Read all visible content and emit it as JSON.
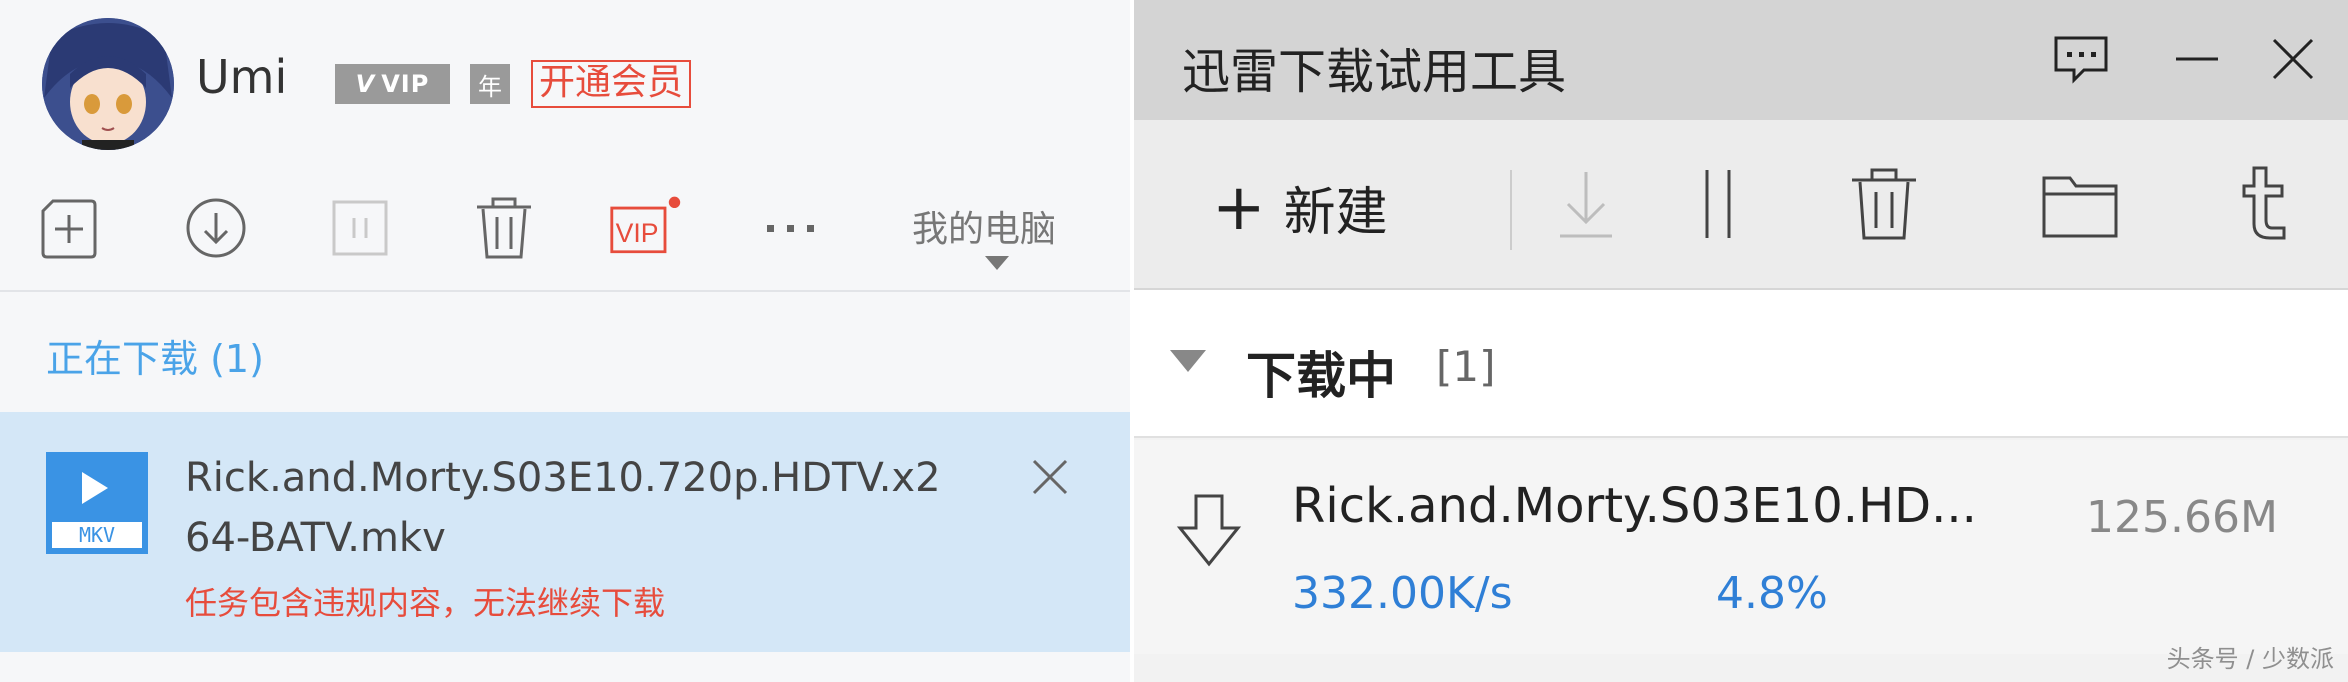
{
  "left_client": {
    "user": {
      "name": "Umi",
      "vip_badge": "VIP",
      "year_badge": "年",
      "open_member": "开通会员"
    },
    "toolbar": {
      "add_icon": "add-task-icon",
      "download_icon": "download-icon",
      "pause_icon": "pause-icon",
      "delete_icon": "trash-icon",
      "vip_icon": "vip-icon",
      "vip_icon_label": "VIP",
      "more_icon": "more-icon",
      "my_pc": "我的电脑"
    },
    "section": {
      "title": "正在下载 (1)"
    },
    "task": {
      "file_ext": "MKV",
      "file_name": "Rick.and.Morty.S03E10.720p.HDTV.x264-BATV.mkv",
      "error": "任务包含违规内容，无法继续下载"
    }
  },
  "right_client": {
    "title": "迅雷下载试用工具",
    "window_buttons": [
      "feedback-icon",
      "minimize-icon",
      "close-icon"
    ],
    "toolbar": {
      "new_label": "新建"
    },
    "group": {
      "name": "下载中",
      "count": "[1]"
    },
    "download": {
      "name": "Rick.and.Morty.S03E10.HD...",
      "size": "125.66M",
      "speed": "332.00K/s",
      "percent": "4.8%",
      "progress_fraction": 0.048
    }
  },
  "watermark": "头条号 / 少数派",
  "colors": {
    "accent_blue": "#3a93e4",
    "error_red": "#e74c3c",
    "selected_row": "#d4e7f7"
  }
}
